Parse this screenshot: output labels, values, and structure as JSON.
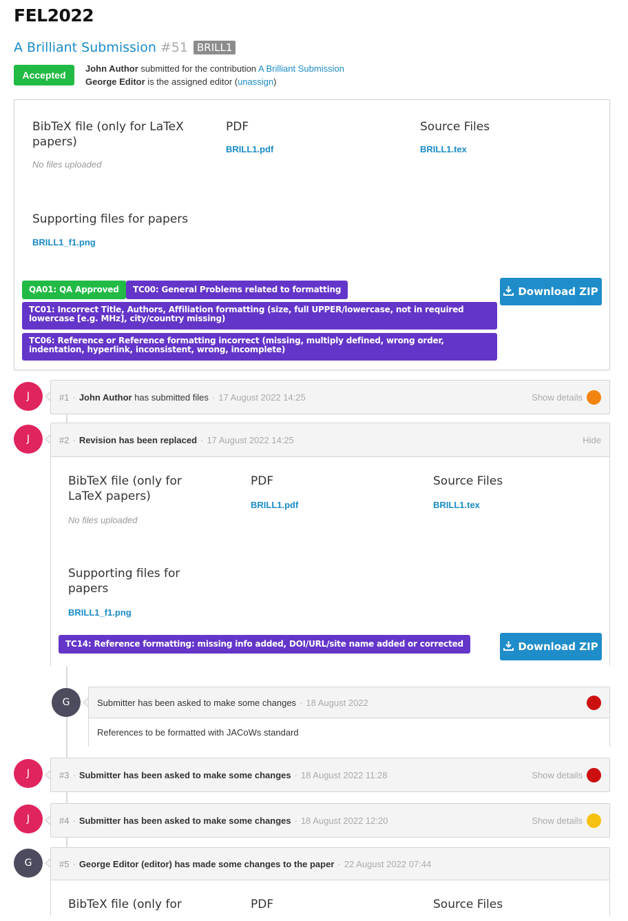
{
  "event": {
    "title": "FEL2022"
  },
  "submission": {
    "title": "A Brilliant Submission",
    "number": "#51",
    "code": "BRILL1",
    "status": "Accepted",
    "submitter_name": "John Author",
    "submitted_text": " submitted for the contribution ",
    "contribution_link": "A Brilliant Submission",
    "editor_name": "George Editor",
    "editor_text": " is the assigned editor (",
    "unassign_label": "unassign",
    "editor_close": ")"
  },
  "files_card": {
    "bibtex_title": "BibTeX file (only for LaTeX papers)",
    "bibtex_empty": "No files uploaded",
    "pdf_title": "PDF",
    "pdf_file": "BRILL1.pdf",
    "source_title": "Source Files",
    "source_file": "BRILL1.tex",
    "supporting_title": "Supporting files for papers",
    "supporting_file": "BRILL1_f1.png",
    "tags": [
      "QA01: QA Approved",
      "TC00: General Problems related to formatting",
      "TC01: Incorrect Title, Authors, Affiliation formatting (size, full UPPER/lowercase, not in required lowercase [e.g. MHz], city/country missing)",
      "TC06: Reference or Reference formatting incorrect (missing, multiply defined, wrong order, indentation, hyperlink, inconsistent, wrong, incomplete)"
    ],
    "download_label": "Download ZIP"
  },
  "timeline": {
    "entries": [
      {
        "index": "#1",
        "avatar": "J",
        "actor": "John Author",
        "action": " has submitted files",
        "date": "17 August 2022 14:25",
        "right_label": "Show details",
        "dot_color": "#f2850f"
      },
      {
        "index": "#2",
        "avatar": "J",
        "actor": "",
        "action": "Revision has been replaced",
        "date": "17 August 2022 14:25",
        "right_label": "Hide",
        "body": {
          "bibtex_title": "BibTeX file (only for LaTeX papers)",
          "bibtex_empty": "No files uploaded",
          "pdf_title": "PDF",
          "pdf_file": "BRILL1.pdf",
          "source_title": "Source Files",
          "source_file": "BRILL1.tex",
          "supporting_title": "Supporting files for papers",
          "supporting_file": "BRILL1_f1.png",
          "tag": "TC14: Reference formatting: missing info added, DOI/URL/site name added or corrected",
          "download_label": "Download ZIP"
        }
      },
      {
        "index": "",
        "avatar": "G",
        "action": "Submitter has been asked to make some changes",
        "date": "18 August 2022",
        "comment": "References to be formatted with JACoWs standard",
        "dot_color": "#cc1010"
      },
      {
        "index": "#3",
        "avatar": "J",
        "action": "Submitter has been asked to make some changes",
        "date": "18 August 2022 11:28",
        "right_label": "Show details",
        "dot_color": "#cc1010"
      },
      {
        "index": "#4",
        "avatar": "J",
        "action": "Submitter has been asked to make some changes",
        "date": "18 August 2022 12:20",
        "right_label": "Show details",
        "dot_color": "#f7c20f"
      },
      {
        "index": "#5",
        "avatar": "G",
        "action": "George Editor (editor) has made some changes to the paper",
        "date": "22 August 2022 07:44",
        "body": {
          "bibtex_title": "BibTeX file (only for",
          "pdf_title": "PDF",
          "source_title": "Source Files"
        }
      }
    ]
  },
  "icons": {
    "download": "download-icon"
  }
}
